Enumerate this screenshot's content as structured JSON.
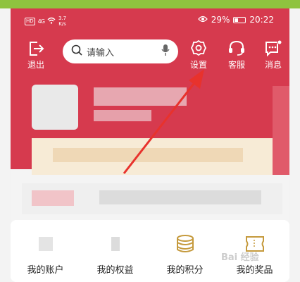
{
  "status_bar": {
    "hd": "HD",
    "signal": "4G",
    "speed_value": "3.7",
    "speed_unit": "K/s",
    "battery": "29%",
    "time": "20:22"
  },
  "toolbar": {
    "logout_label": "退出",
    "settings_label": "设置",
    "service_label": "客服",
    "message_label": "消息"
  },
  "search": {
    "placeholder": "请输入"
  },
  "tiles": [
    {
      "label": "我的账户"
    },
    {
      "label": "我的权益"
    },
    {
      "label": "我的积分"
    },
    {
      "label": "我的奖品"
    }
  ],
  "watermark": "Bai 经验",
  "colors": {
    "header": "#d63a4e",
    "accent_gold": "#c59a3d",
    "arrow": "#e8322c",
    "top_strip": "#8fc33f"
  }
}
